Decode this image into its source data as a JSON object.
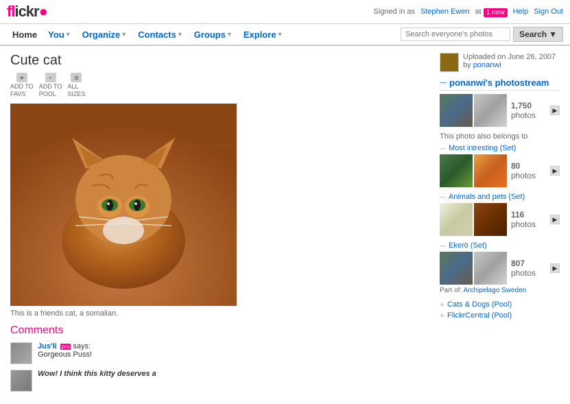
{
  "header": {
    "logo": "flickr",
    "logo_dot": "r",
    "signed_in_text": "Signed in as",
    "username": "Stephen Ewen",
    "messages_text": "1 new",
    "help_link": "Help",
    "signout_link": "Sign Out"
  },
  "navbar": {
    "items": [
      {
        "label": "Home",
        "active": true,
        "dropdown": false
      },
      {
        "label": "You",
        "active": false,
        "dropdown": true
      },
      {
        "label": "Organize",
        "active": false,
        "dropdown": true
      },
      {
        "label": "Contacts",
        "active": false,
        "dropdown": true
      },
      {
        "label": "Groups",
        "active": false,
        "dropdown": true
      },
      {
        "label": "Explore",
        "active": false,
        "dropdown": true
      }
    ],
    "search_placeholder": "Search everyone's photos",
    "search_button": "Search"
  },
  "photo": {
    "title": "Cute cat",
    "actions": [
      {
        "label": "ADD TO\nFAVS",
        "icon": "star"
      },
      {
        "label": "ADD TO\nPOOL",
        "icon": "pool"
      },
      {
        "label": "ALL\nSIZES",
        "icon": "sizes"
      }
    ],
    "caption": "This is a friends cat, a somalian.",
    "uploaded_text": "Uploaded on June 26, 2007",
    "uploaded_by": "by",
    "uploader": "ponanwi"
  },
  "photostream": {
    "title": "ponanwi's photostream",
    "count": "1,750",
    "count_label": "photos",
    "thumbs": [
      {
        "id": 1,
        "style": "strip-thumb-1"
      },
      {
        "id": 2,
        "style": "strip-thumb-2"
      },
      {
        "id": 3,
        "style": "strip-thumb-3"
      }
    ]
  },
  "belongs_to": {
    "label": "This photo also belongs to",
    "sets": [
      {
        "name": "Most intresting (Set)",
        "count": "80",
        "count_label": "photos",
        "thumbs": [
          {
            "style": "strip-thumb-4"
          },
          {
            "style": "strip-thumb-5"
          },
          {
            "style": "strip-thumb-6"
          }
        ]
      },
      {
        "name": "Animals and pets (Set)",
        "count": "116",
        "count_label": "photos",
        "thumbs": [
          {
            "style": "strip-thumb-7"
          },
          {
            "style": "strip-thumb-8"
          },
          {
            "style": "strip-thumb-3"
          }
        ]
      },
      {
        "name": "Ekerö (Set)",
        "count": "807",
        "count_label": "photos",
        "thumbs": [
          {
            "style": "strip-thumb-1"
          },
          {
            "style": "strip-thumb-2"
          },
          {
            "style": "strip-thumb-7"
          }
        ]
      }
    ]
  },
  "part_of_text": "Part of: Archipelago Sweden",
  "pools": [
    {
      "label": "Cats & Dogs (Pool)"
    },
    {
      "label": "FlickrCentral (Pool)"
    }
  ],
  "comments": {
    "title": "Comments",
    "items": [
      {
        "user": "Jus'li",
        "pro": true,
        "says": "says:",
        "text": "Gorgeous Puss!"
      },
      {
        "user": "",
        "pro": false,
        "says": "",
        "text": "Wow! I think this kitty deserves a"
      }
    ]
  }
}
